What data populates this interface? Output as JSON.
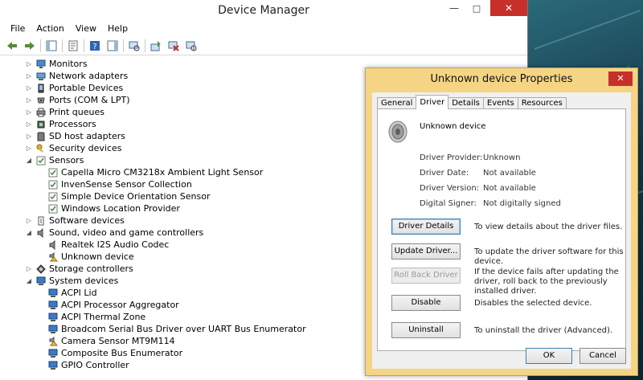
{
  "device_manager": {
    "title": "Device Manager",
    "menu": [
      "File",
      "Action",
      "View",
      "Help"
    ],
    "tree": [
      {
        "label": "Monitors",
        "level": 1,
        "expanded": false,
        "icon": "monitor-icon"
      },
      {
        "label": "Network adapters",
        "level": 1,
        "expanded": false,
        "icon": "network-icon"
      },
      {
        "label": "Portable Devices",
        "level": 1,
        "expanded": false,
        "icon": "portable-device-icon"
      },
      {
        "label": "Ports (COM & LPT)",
        "level": 1,
        "expanded": false,
        "icon": "port-icon"
      },
      {
        "label": "Print queues",
        "level": 1,
        "expanded": false,
        "icon": "printer-icon"
      },
      {
        "label": "Processors",
        "level": 1,
        "expanded": false,
        "icon": "processor-icon"
      },
      {
        "label": "SD host adapters",
        "level": 1,
        "expanded": false,
        "icon": "sd-card-icon"
      },
      {
        "label": "Security devices",
        "level": 1,
        "expanded": false,
        "icon": "key-icon"
      },
      {
        "label": "Sensors",
        "level": 1,
        "expanded": true,
        "icon": "sensor-icon"
      },
      {
        "label": "Capella Micro CM3218x Ambient Light Sensor",
        "level": 2,
        "icon": "sensor-icon"
      },
      {
        "label": "InvenSense Sensor Collection",
        "level": 2,
        "icon": "sensor-icon"
      },
      {
        "label": "Simple Device Orientation Sensor",
        "level": 2,
        "icon": "sensor-icon"
      },
      {
        "label": "Windows Location Provider",
        "level": 2,
        "icon": "sensor-icon"
      },
      {
        "label": "Software devices",
        "level": 1,
        "expanded": false,
        "icon": "software-device-icon"
      },
      {
        "label": "Sound, video and game controllers",
        "level": 1,
        "expanded": true,
        "icon": "speaker-icon"
      },
      {
        "label": "Realtek I2S Audio Codec",
        "level": 2,
        "icon": "speaker-icon"
      },
      {
        "label": "Unknown device",
        "level": 2,
        "icon": "warning-device-icon"
      },
      {
        "label": "Storage controllers",
        "level": 1,
        "expanded": false,
        "icon": "storage-icon"
      },
      {
        "label": "System devices",
        "level": 1,
        "expanded": true,
        "icon": "system-device-icon"
      },
      {
        "label": "ACPI Lid",
        "level": 2,
        "icon": "system-device-icon"
      },
      {
        "label": "ACPI Processor Aggregator",
        "level": 2,
        "icon": "system-device-icon"
      },
      {
        "label": "ACPI Thermal Zone",
        "level": 2,
        "icon": "system-device-icon"
      },
      {
        "label": "Broadcom Serial Bus Driver over UART Bus Enumerator",
        "level": 2,
        "icon": "system-device-icon"
      },
      {
        "label": "Camera Sensor MT9M114",
        "level": 2,
        "icon": "warning-device-icon"
      },
      {
        "label": "Composite Bus Enumerator",
        "level": 2,
        "icon": "system-device-icon"
      },
      {
        "label": "GPIO Controller",
        "level": 2,
        "icon": "system-device-icon"
      }
    ]
  },
  "properties": {
    "title": "Unknown device Properties",
    "tabs": [
      "General",
      "Driver",
      "Details",
      "Events",
      "Resources"
    ],
    "active_tab": "Driver",
    "device_name": "Unknown device",
    "info": [
      {
        "label": "Driver Provider:",
        "value": "Unknown"
      },
      {
        "label": "Driver Date:",
        "value": "Not available"
      },
      {
        "label": "Driver Version:",
        "value": "Not available"
      },
      {
        "label": "Digital Signer:",
        "value": "Not digitally signed"
      }
    ],
    "actions": [
      {
        "button": "Driver Details",
        "desc": "To view details about the driver files.",
        "enabled": true
      },
      {
        "button": "Update Driver...",
        "desc": "To update the driver software for this device.",
        "enabled": true
      },
      {
        "button": "Roll Back Driver",
        "desc": "If the device fails after updating the driver, roll back to the previously installed driver.",
        "enabled": false
      },
      {
        "button": "Disable",
        "desc": "Disables the selected device.",
        "enabled": true
      },
      {
        "button": "Uninstall",
        "desc": "To uninstall the driver (Advanced).",
        "enabled": true
      }
    ],
    "ok_label": "OK",
    "cancel_label": "Cancel"
  }
}
